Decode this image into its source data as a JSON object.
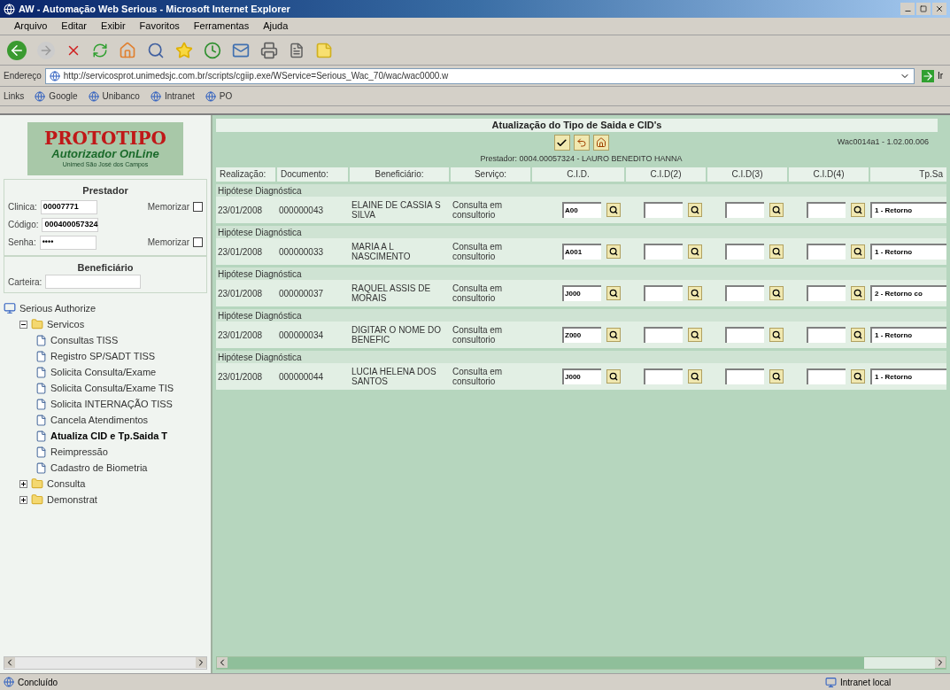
{
  "window": {
    "title": "AW - Automação Web Serious - Microsoft Internet Explorer"
  },
  "menu": [
    "Arquivo",
    "Editar",
    "Exibir",
    "Favoritos",
    "Ferramentas",
    "Ajuda"
  ],
  "address": {
    "label": "Endereço",
    "url": "http://servicosprot.unimedsjc.com.br/scripts/cgiip.exe/WService=Serious_Wac_70/wac/wac0000.w",
    "go": "Ir"
  },
  "links": {
    "label": "Links",
    "items": [
      "Google",
      "Unibanco",
      "Intranet",
      "PO"
    ]
  },
  "sidebar": {
    "logo": {
      "title": "PROTOTIPO",
      "subtitle": "Autorizador OnLine",
      "tagline": "Unimed São José dos Campos"
    },
    "prestador": {
      "heading": "Prestador",
      "fields": [
        {
          "label": "Clinica:",
          "value": "00007771",
          "memorize": {
            "label": "Memorizar",
            "checked": false
          }
        },
        {
          "label": "Código:",
          "value": "000400057324"
        },
        {
          "label": "Senha:",
          "value": "••••",
          "memorize": {
            "label": "Memorizar",
            "checked": false
          }
        }
      ]
    },
    "beneficiario": {
      "heading": "Beneficiário",
      "label": "Carteira:"
    },
    "tree": [
      {
        "label": "Serious Authorize",
        "kind": "root",
        "children": [
          {
            "label": "Servicos",
            "kind": "folder",
            "expanded": true,
            "children": [
              {
                "label": "Consultas TISS",
                "kind": "page",
                "selected": false
              },
              {
                "label": "Registro SP/SADT TISS",
                "kind": "page",
                "selected": false
              },
              {
                "label": "Solicita Consulta/Exame",
                "kind": "page",
                "selected": false
              },
              {
                "label": "Solicita Consulta/Exame TIS",
                "kind": "page",
                "selected": false
              },
              {
                "label": "Solicita INTERNAÇÃO TISS",
                "kind": "page",
                "selected": false
              },
              {
                "label": "Cancela Atendimentos",
                "kind": "page",
                "selected": false
              },
              {
                "label": "Atualiza CID e Tp.Saida T",
                "kind": "page",
                "selected": true
              },
              {
                "label": "Reimpressão",
                "kind": "page",
                "selected": false
              },
              {
                "label": "Cadastro de Biometria",
                "kind": "page",
                "selected": false
              }
            ]
          },
          {
            "label": "Consulta",
            "kind": "folder",
            "expanded": false
          },
          {
            "label": "Demonstrat",
            "kind": "folder",
            "expanded": false
          }
        ]
      }
    ]
  },
  "main": {
    "title": "Atualização do Tipo de Saida e CID's",
    "version": "Wac0014a1 - 1.02.00.006",
    "prestador": "Prestador: 0004.00057324 - LAURO BENEDITO HANNA",
    "columns": [
      "Realização:",
      "Documento:",
      "Beneficiário:",
      "Serviço:",
      "C.I.D.",
      "C.I.D(2)",
      "C.I.D(3)",
      "C.I.D(4)",
      "Tp.Sa"
    ],
    "rows": [
      {
        "section": "Hipótese Diagnóstica",
        "date": "23/01/2008",
        "document": "000000043",
        "beneficiary": "ELAINE DE CASSIA S SILVA",
        "service": "Consulta em consultorio",
        "cid": "A00",
        "exit_type": "1 - Retorno"
      },
      {
        "section": "Hipótese Diagnóstica",
        "date": "23/01/2008",
        "document": "000000033",
        "beneficiary": "MARIA A L NASCIMENTO",
        "service": "Consulta em consultorio",
        "cid": "A001",
        "exit_type": "1 - Retorno"
      },
      {
        "section": "Hipótese Diagnóstica",
        "date": "23/01/2008",
        "document": "000000037",
        "beneficiary": "RAQUEL ASSIS DE MORAIS",
        "service": "Consulta em consultorio",
        "cid": "J000",
        "exit_type": "2 - Retorno co"
      },
      {
        "section": "Hipótese Diagnóstica",
        "date": "23/01/2008",
        "document": "000000034",
        "beneficiary": "DIGITAR O NOME DO BENEFIC",
        "service": "Consulta em consultorio",
        "cid": "Z000",
        "exit_type": "1 - Retorno"
      },
      {
        "section": "Hipótese Diagnóstica",
        "date": "23/01/2008",
        "document": "000000044",
        "beneficiary": "LUCIA HELENA DOS SANTOS",
        "service": "Consulta em consultorio",
        "cid": "J000",
        "exit_type": "1 - Retorno"
      }
    ]
  },
  "status_bar": {
    "text": "Concluído",
    "zone": "Intranet local"
  }
}
